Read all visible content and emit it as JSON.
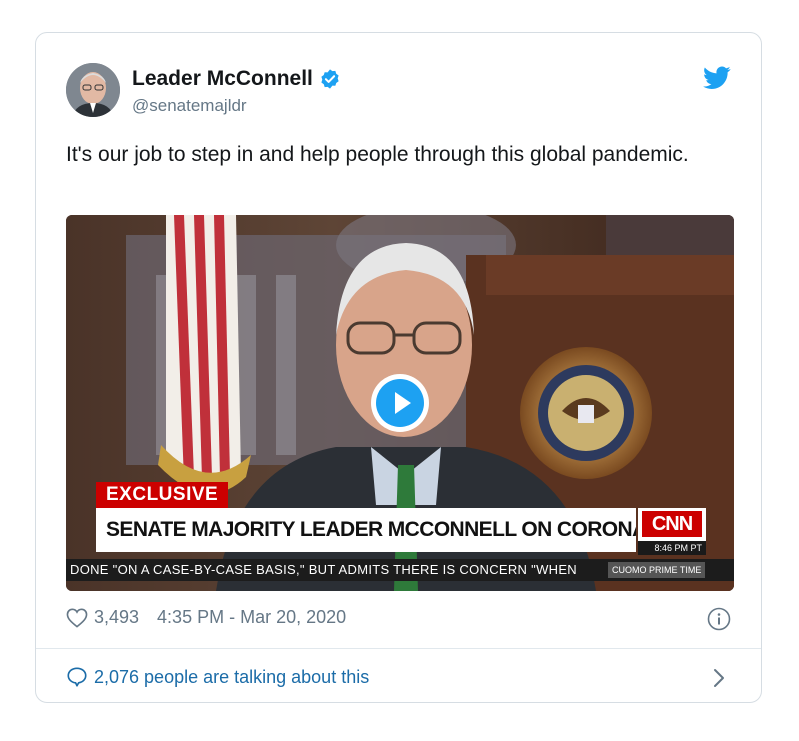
{
  "tweet": {
    "author_name": "Leader McConnell",
    "handle": "@senatemajldr",
    "text": "It's our job to step in and help people through this global pandemic.",
    "likes": "3,493",
    "timestamp": "4:35 PM - Mar 20, 2020",
    "talking": "2,076 people are talking about this"
  },
  "video": {
    "exclusive_label": "EXCLUSIVE",
    "headline": "SENATE MAJORITY LEADER MCCONNELL ON CORONAVIRUS RESPONSE",
    "network": "CNN",
    "time": "8:46 PM PT",
    "ticker": "DONE \"ON A CASE-BY-CASE BASIS,\" BUT ADMITS THERE IS CONCERN \"WHEN",
    "program": "CUOMO PRIME TIME"
  },
  "icons": {
    "verified": "verified-badge-icon",
    "platform": "twitter-bird-icon",
    "play": "play-icon",
    "like": "heart-icon",
    "info": "info-icon",
    "reply": "speech-bubble-icon",
    "more": "chevron-right-icon"
  },
  "colors": {
    "brand_blue": "#1da1f2",
    "link_blue": "#1b6ca8",
    "muted": "#657786",
    "cnn_red": "#cc0000"
  }
}
